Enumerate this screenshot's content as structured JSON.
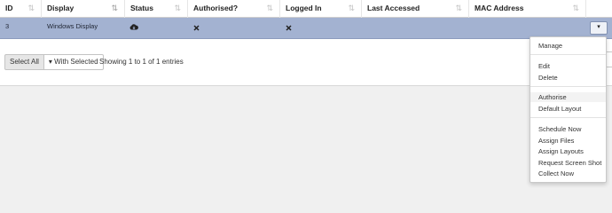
{
  "table": {
    "columns": [
      {
        "label": "ID",
        "sort_icon": "sort-icon"
      },
      {
        "label": "Display",
        "sort_icon": "sort-alpha-icon"
      },
      {
        "label": "Status",
        "sort_icon": "sort-icon"
      },
      {
        "label": "Authorised?",
        "sort_icon": "sort-icon"
      },
      {
        "label": "Logged In",
        "sort_icon": "sort-icon"
      },
      {
        "label": "Last Accessed",
        "sort_icon": "sort-icon"
      },
      {
        "label": "MAC Address",
        "sort_icon": "sort-icon"
      }
    ],
    "rows": [
      {
        "id": "3",
        "display": "Windows Display",
        "status_icon": "cloud-download-icon",
        "authorised_icon": "times-icon",
        "logged_in_icon": "times-icon",
        "last_accessed": "",
        "mac_address": ""
      }
    ],
    "row_selected_color": "#a3b2d1"
  },
  "footer": {
    "select_all_label": "Select All",
    "with_selected_label": "With Selected",
    "with_selected_icon": "caret-down-icon",
    "info_text": "Showing 1 to 1 of 1 entries"
  },
  "row_menu": {
    "sections": [
      [
        "Manage"
      ],
      [
        "Edit",
        "Delete"
      ],
      [
        "Authorise",
        "Default Layout"
      ],
      [
        "Schedule Now",
        "Assign Files",
        "Assign Layouts",
        "Request Screen Shot",
        "Collect Now"
      ]
    ],
    "hovered_item": "Authorise"
  }
}
